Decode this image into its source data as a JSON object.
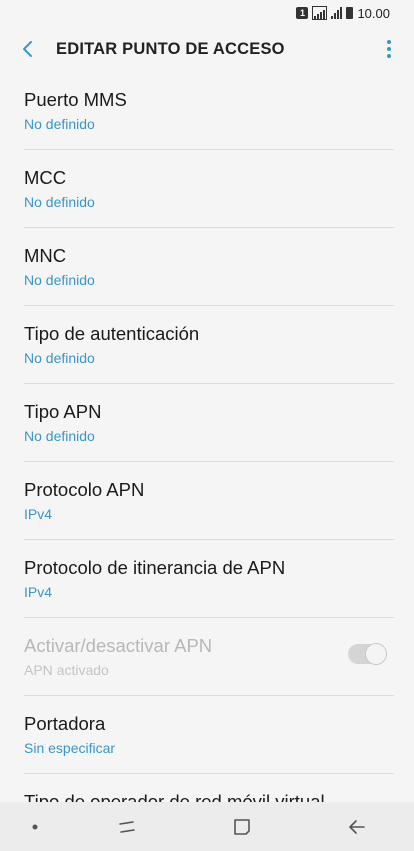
{
  "status_bar": {
    "sim": "1",
    "time": "10.00"
  },
  "app_bar": {
    "title": "EDITAR PUNTO DE ACCESO"
  },
  "items": [
    {
      "label": "Puerto MMS",
      "value": "No definido"
    },
    {
      "label": "MCC",
      "value": "No definido"
    },
    {
      "label": "MNC",
      "value": "No definido"
    },
    {
      "label": "Tipo de autenticación",
      "value": "No definido"
    },
    {
      "label": "Tipo APN",
      "value": "No definido"
    },
    {
      "label": "Protocolo APN",
      "value": "IPv4"
    },
    {
      "label": "Protocolo de itinerancia de APN",
      "value": "IPv4"
    },
    {
      "label": "Activar/desactivar APN",
      "value": "APN activado",
      "toggle_on": true,
      "disabled": true
    },
    {
      "label": "Portadora",
      "value": "Sin especificar"
    },
    {
      "label": "Tipo de operador de red móvil virtual"
    }
  ],
  "colors": {
    "accent": "#3a95c8",
    "background": "#f5f5f5",
    "divider": "#dcdcdc",
    "disabled_text": "#b8b8b8"
  },
  "icons": {
    "back": "chevron-left-icon",
    "more": "more-vertical-icon",
    "nav_recents": "recents-icon",
    "nav_home": "home-icon",
    "nav_back": "back-arrow-icon"
  }
}
